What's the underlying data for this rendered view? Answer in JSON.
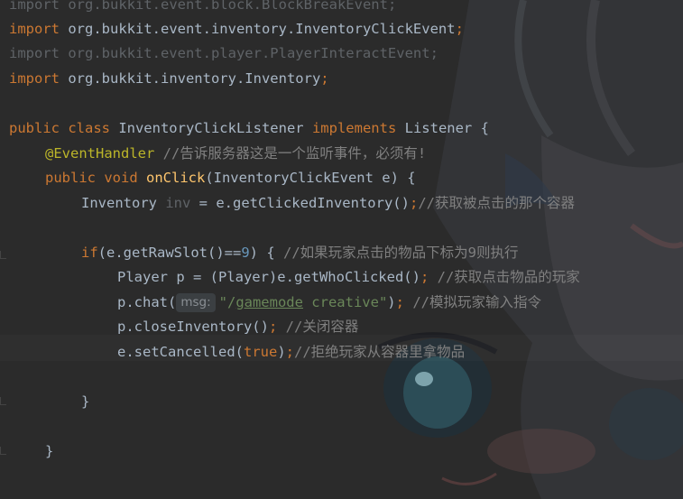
{
  "editor": {
    "lines": {
      "l1_kw": "import",
      "l1_rest": " org.bukkit.event.block.BlockBreakEvent;",
      "l2_kw": "import",
      "l2_rest": " org.bukkit.event.inventory.InventoryClickEvent",
      "l2_semi": ";",
      "l3_text": "import org.bukkit.event.player.PlayerInteractEvent;",
      "l4_kw": "import",
      "l4_rest": " org.bukkit.inventory.Inventory",
      "l4_semi": ";",
      "l5_kw1": "public class",
      "l5_name": " InventoryClickListener ",
      "l5_kw2": "implements",
      "l5_rest": " Listener {",
      "l6_ann": "@EventHandler",
      "l6_cm": " //告诉服务器这是一个监听事件，必须有!",
      "l7_kw": "public void",
      "l7_fn": " onClick",
      "l7_rest": "(InventoryClickEvent e) {",
      "l8_type": "Inventory ",
      "l8_var": "inv",
      "l8_rest": " = e.getClickedInventory()",
      "l8_semi": ";",
      "l8_cm": "//获取被点击的那个容器",
      "l9_kw": "if",
      "l9_a": "(e.getRawSlot()==",
      "l9_num": "9",
      "l9_b": ") { ",
      "l9_cm": "//如果玩家点击的物品下标为9则执行",
      "l10_a": "Player p = (Player)e.getWhoClicked()",
      "l10_semi": ";",
      "l10_cm": " //获取点击物品的玩家",
      "l11_a": "p.chat(",
      "l11_hint": "msg:",
      "l11_q1": "\"/",
      "l11_gm": "gamemode",
      "l11_q2": " creative\"",
      "l11_b": ")",
      "l11_semi": ";",
      "l11_cm": " //模拟玩家输入指令",
      "l12_a": "p.closeInventory()",
      "l12_semi": ";",
      "l12_cm": " //关闭容器",
      "l13_a": "e.setCancelled(",
      "l13_kw": "true",
      "l13_b": ")",
      "l13_semi": ";",
      "l13_cm": "//拒绝玩家从容器里拿物品",
      "l14_brace": "}",
      "l15_brace": "}"
    }
  }
}
